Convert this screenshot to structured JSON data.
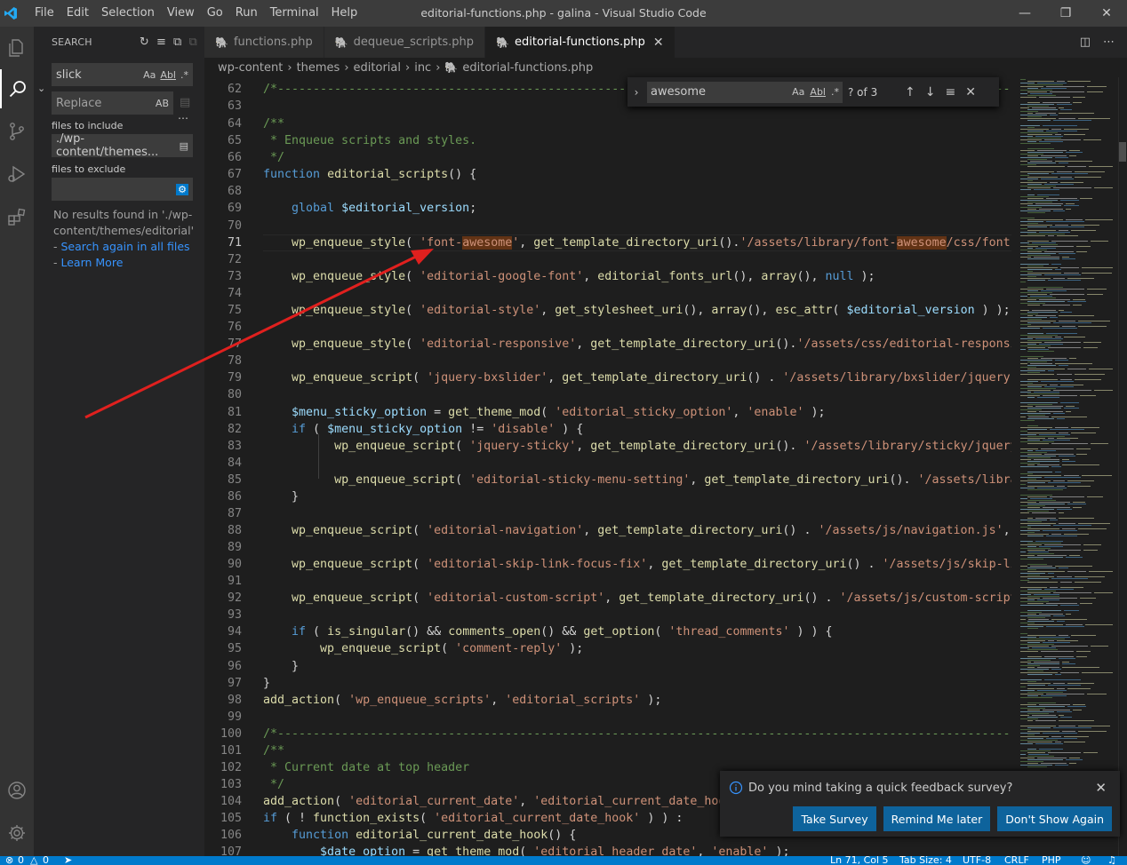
{
  "window": {
    "title": "editorial-functions.php - galina - Visual Studio Code",
    "menu": [
      "File",
      "Edit",
      "Selection",
      "View",
      "Go",
      "Run",
      "Terminal",
      "Help"
    ]
  },
  "sidebar": {
    "title": "SEARCH",
    "search_value": "slick",
    "replace_placeholder": "Replace",
    "files_include_label": "files to include",
    "files_include_value": "./wp-content/themes...",
    "files_exclude_label": "files to exclude",
    "files_exclude_value": "",
    "no_results": "No results found in './wp-content/themes/editorial'",
    "search_again": "Search again in all files",
    "learn_more": "Learn More",
    "case_toggle": "Aa",
    "word_toggle": "Abl",
    "regex_toggle": ".*",
    "preserve_case": "AB"
  },
  "tabs": [
    {
      "label": "functions.php",
      "active": false
    },
    {
      "label": "dequeue_scripts.php",
      "active": false
    },
    {
      "label": "editorial-functions.php",
      "active": true
    }
  ],
  "breadcrumb": [
    "wp-content",
    "themes",
    "editorial",
    "inc",
    "editorial-functions.php"
  ],
  "find": {
    "value": "awesome",
    "count": "? of 3",
    "case_toggle": "Aa",
    "word_toggle": "Abl",
    "regex_toggle": ".*"
  },
  "code_lines": [
    {
      "n": "62",
      "html": "<span class='cm'>/*------------------------------------------------------------------------------------------------------------------------------</span>"
    },
    {
      "n": "63",
      "html": ""
    },
    {
      "n": "64",
      "html": "<span class='cm'>/**</span>"
    },
    {
      "n": "65",
      "html": "<span class='cm'> * Enqueue scripts and styles.</span>"
    },
    {
      "n": "66",
      "html": "<span class='cm'> */</span>"
    },
    {
      "n": "67",
      "html": "<span class='kw'>function</span> <span class='fn'>editorial_scripts</span>() {"
    },
    {
      "n": "68",
      "html": ""
    },
    {
      "n": "69",
      "html": "    <span class='kw'>global</span> <span class='var'>$editorial_version</span>;"
    },
    {
      "n": "70",
      "html": ""
    },
    {
      "n": "71",
      "html": "    <span class='fn'>wp_enqueue_style</span>( <span class='str'>'font-<span class='hl'>awesome</span>'</span>, <span class='fn'>get_template_directory_uri</span>().<span class='str'>'/assets/library/font-<span class='hl'>awesome</span>/css/font-awesome.min.css'</span>"
    },
    {
      "n": "72",
      "html": ""
    },
    {
      "n": "73",
      "html": "    <span class='fn'>wp_enqueue_style</span>( <span class='str'>'editorial-google-font'</span>, <span class='fn'>editorial_fonts_url</span>(), <span class='fn'>array</span>(), <span class='kw'>null</span> );"
    },
    {
      "n": "74",
      "html": ""
    },
    {
      "n": "75",
      "html": "    <span class='fn'>wp_enqueue_style</span>( <span class='str'>'editorial-style'</span>, <span class='fn'>get_stylesheet_uri</span>(), <span class='fn'>array</span>(), <span class='fn'>esc_attr</span>( <span class='var'>$editorial_version</span> ) );"
    },
    {
      "n": "76",
      "html": ""
    },
    {
      "n": "77",
      "html": "    <span class='fn'>wp_enqueue_style</span>( <span class='str'>'editorial-responsive'</span>, <span class='fn'>get_template_directory_uri</span>().<span class='str'>'/assets/css/editorial-responsive.css'</span>"
    },
    {
      "n": "78",
      "html": ""
    },
    {
      "n": "79",
      "html": "    <span class='fn'>wp_enqueue_script</span>( <span class='str'>'jquery-bxslider'</span>, <span class='fn'>get_template_directory_uri</span>() . <span class='str'>'/assets/library/bxslider/jquery.bxslider.js'</span>"
    },
    {
      "n": "80",
      "html": ""
    },
    {
      "n": "81",
      "html": "    <span class='var'>$menu_sticky_option</span> = <span class='fn'>get_theme_mod</span>( <span class='str'>'editorial_sticky_option'</span>, <span class='str'>'enable'</span> );"
    },
    {
      "n": "82",
      "html": "    <span class='kw'>if</span> ( <span class='var'>$menu_sticky_option</span> != <span class='str'>'disable'</span> ) {"
    },
    {
      "n": "83",
      "html": "          <span class='fn'>wp_enqueue_script</span>( <span class='str'>'jquery-sticky'</span>, <span class='fn'>get_template_directory_uri</span>(). <span class='str'>'/assets/library/sticky/jquery.sticky.js'</span>"
    },
    {
      "n": "84",
      "html": ""
    },
    {
      "n": "85",
      "html": "          <span class='fn'>wp_enqueue_script</span>( <span class='str'>'editorial-sticky-menu-setting'</span>, <span class='fn'>get_template_directory_uri</span>(). <span class='str'>'/assets/library/sticky/sticky-setting.js'</span>"
    },
    {
      "n": "86",
      "html": "    }"
    },
    {
      "n": "87",
      "html": ""
    },
    {
      "n": "88",
      "html": "    <span class='fn'>wp_enqueue_script</span>( <span class='str'>'editorial-navigation'</span>, <span class='fn'>get_template_directory_uri</span>() . <span class='str'>'/assets/js/navigation.js'</span>, <span class='fn'>array</span>()"
    },
    {
      "n": "89",
      "html": ""
    },
    {
      "n": "90",
      "html": "    <span class='fn'>wp_enqueue_script</span>( <span class='str'>'editorial-skip-link-focus-fix'</span>, <span class='fn'>get_template_directory_uri</span>() . <span class='str'>'/assets/js/skip-link-focus-fix.js'</span>"
    },
    {
      "n": "91",
      "html": ""
    },
    {
      "n": "92",
      "html": "    <span class='fn'>wp_enqueue_script</span>( <span class='str'>'editorial-custom-script'</span>, <span class='fn'>get_template_directory_uri</span>() . <span class='str'>'/assets/js/custom-script.js'</span>"
    },
    {
      "n": "93",
      "html": ""
    },
    {
      "n": "94",
      "html": "    <span class='kw'>if</span> ( <span class='fn'>is_singular</span>() &amp;&amp; <span class='fn'>comments_open</span>() &amp;&amp; <span class='fn'>get_option</span>( <span class='str'>'thread_comments'</span> ) ) {"
    },
    {
      "n": "95",
      "html": "        <span class='fn'>wp_enqueue_script</span>( <span class='str'>'comment-reply'</span> );"
    },
    {
      "n": "96",
      "html": "    }"
    },
    {
      "n": "97",
      "html": "}"
    },
    {
      "n": "98",
      "html": "<span class='fn'>add_action</span>( <span class='str'>'wp_enqueue_scripts'</span>, <span class='str'>'editorial_scripts'</span> );"
    },
    {
      "n": "99",
      "html": ""
    },
    {
      "n": "100",
      "html": "<span class='cm'>/*------------------------------------------------------------------------------------------------------------------------------</span>"
    },
    {
      "n": "101",
      "html": "<span class='cm'>/**</span>"
    },
    {
      "n": "102",
      "html": "<span class='cm'> * Current date at top header</span>"
    },
    {
      "n": "103",
      "html": "<span class='cm'> */</span>"
    },
    {
      "n": "104",
      "html": "<span class='fn'>add_action</span>( <span class='str'>'editorial_current_date'</span>, <span class='str'>'editorial_current_date_hook'</span> );"
    },
    {
      "n": "105",
      "html": "<span class='kw'>if</span> ( ! <span class='fn'>function_exists</span>( <span class='str'>'editorial_current_date_hook'</span> ) ) :"
    },
    {
      "n": "106",
      "html": "    <span class='kw'>function</span> <span class='fn'>editorial_current_date_hook</span>() {"
    },
    {
      "n": "107",
      "html": "        <span class='var'>$date_option</span> = <span class='fn'>get_theme_mod</span>( <span class='str'>'editorial_header_date'</span>, <span class='str'>'enable'</span> );"
    }
  ],
  "notification": {
    "message": "Do you mind taking a quick feedback survey?",
    "buttons": [
      "Take Survey",
      "Remind Me later",
      "Don't Show Again"
    ]
  },
  "status": {
    "errors": "0",
    "warnings": "0",
    "position": "Ln 71, Col 5",
    "tab_size": "Tab Size: 4",
    "encoding": "UTF-8",
    "eol": "CRLF",
    "language": "PHP"
  },
  "colors": {
    "accent": "#007acc",
    "button": "#0e639c",
    "find_highlight": "#623315",
    "annotation_arrow": "#e0201e"
  }
}
